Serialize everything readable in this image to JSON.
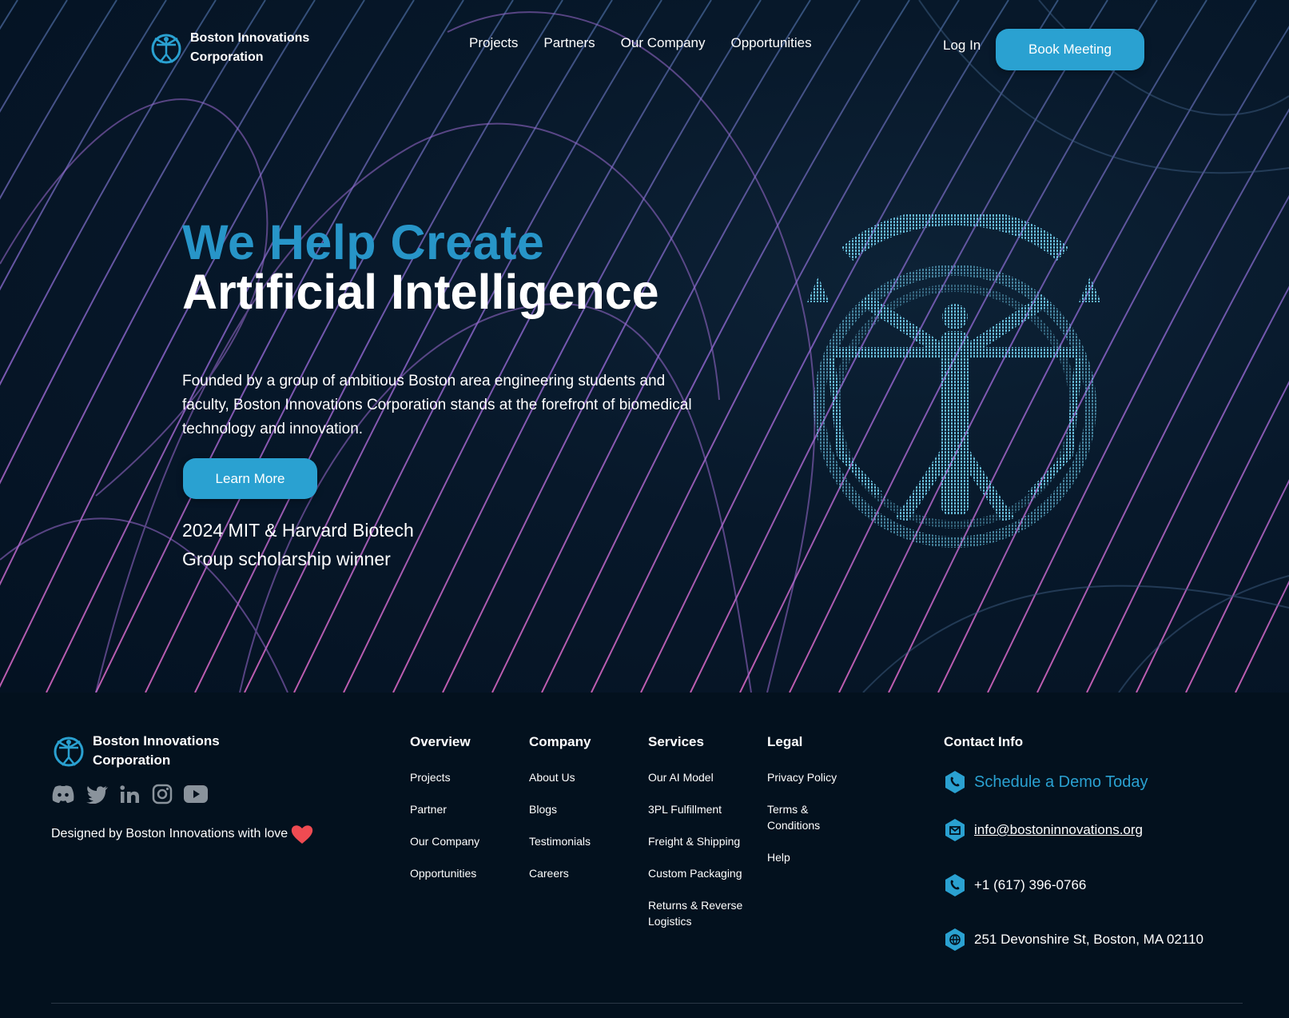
{
  "header": {
    "brand_line1": "Boston Innovations",
    "brand_line2": "Corporation",
    "nav": [
      "Projects",
      "Partners",
      "Our Company",
      "Opportunities"
    ],
    "login_label": "Log In",
    "book_label": "Book Meeting"
  },
  "hero": {
    "title_line1": "We Help Create",
    "title_line2": "Artificial Intelligence",
    "description": "Founded by a group of ambitious Boston area engineering students and faculty, Boston Innovations Corporation stands at the forefront of biomedical technology and innovation.",
    "learn_more_label": "Learn More",
    "award_line1": "2024 MIT & Harvard Biotech",
    "award_line2": "Group scholarship winner"
  },
  "footer": {
    "brand_line1": "Boston Innovations",
    "brand_line2": "Corporation",
    "social_icons": [
      "discord-icon",
      "twitter-icon",
      "linkedin-icon",
      "instagram-icon",
      "youtube-icon"
    ],
    "designed_by": "Designed by Boston Innovations with love",
    "columns": [
      {
        "title": "Overview",
        "links": [
          "Projects",
          "Partner",
          "Our Company",
          "Opportunities"
        ]
      },
      {
        "title": "Company",
        "links": [
          "About Us",
          "Blogs",
          "Testimonials",
          "Careers"
        ]
      },
      {
        "title": "Services",
        "links": [
          "Our AI Model",
          "3PL Fulfillment",
          "Freight & Shipping",
          "Custom Packaging",
          "Returns & Reverse Logistics"
        ]
      },
      {
        "title": "Legal",
        "links": [
          "Privacy Policy",
          "Terms & Conditions",
          "Help"
        ]
      }
    ],
    "contact": {
      "title": "Contact Info",
      "demo": "Schedule a Demo Today",
      "email": "info@bostoninnovations.org",
      "phone": "+1 (617) 396-0766",
      "address": "251 Devonshire St, Boston, MA 02110"
    }
  },
  "colors": {
    "accent": "#2aa1d1",
    "title_blue": "#2795c8",
    "background": "#03111e",
    "heart": "#ef4b52"
  }
}
